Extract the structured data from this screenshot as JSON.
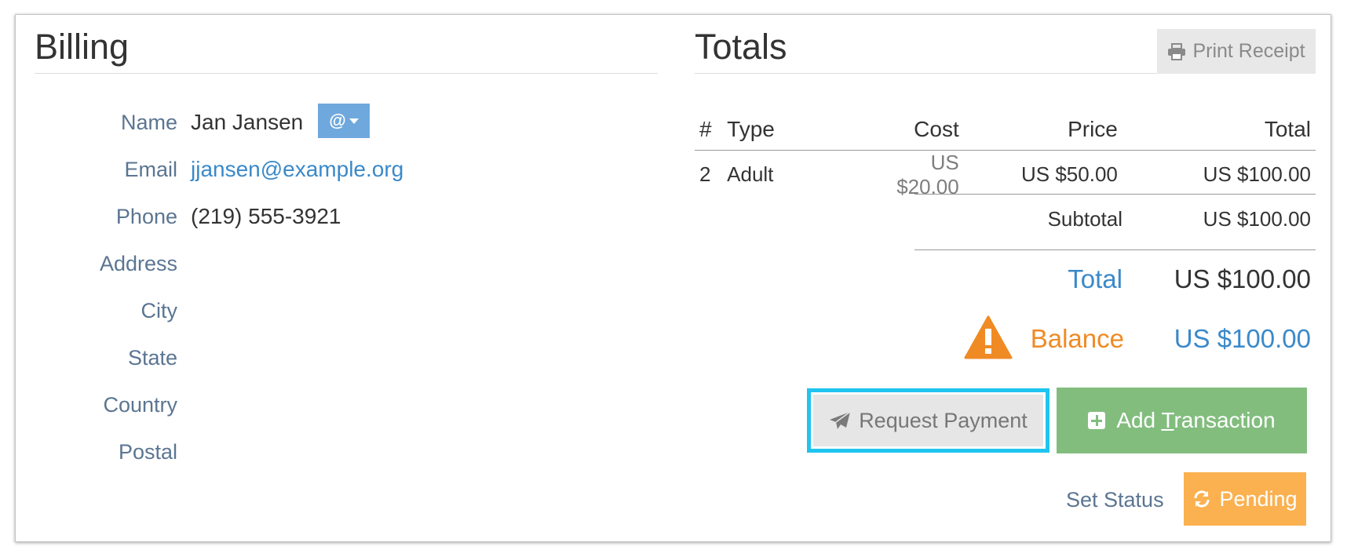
{
  "billing": {
    "title": "Billing",
    "fields": [
      {
        "label": "Name",
        "value": "Jan Jansen"
      },
      {
        "label": "Email",
        "value": "jjansen@example.org"
      },
      {
        "label": "Phone",
        "value": "(219) 555-3921"
      },
      {
        "label": "Address",
        "value": ""
      },
      {
        "label": "City",
        "value": ""
      },
      {
        "label": "State",
        "value": ""
      },
      {
        "label": "Country",
        "value": ""
      },
      {
        "label": "Postal",
        "value": ""
      }
    ],
    "at_button_label": "@"
  },
  "totals": {
    "title": "Totals",
    "print_label": "Print Receipt",
    "table": {
      "headers": [
        "#",
        "Type",
        "Cost",
        "Price",
        "Total"
      ],
      "rows": [
        [
          "2",
          "Adult",
          "US $20.00",
          "US $50.00",
          "US $100.00"
        ]
      ]
    },
    "subtotal_label": "Subtotal",
    "subtotal_value": "US $100.00",
    "total_label": "Total",
    "total_value": "US $100.00",
    "balance_label": "Balance",
    "balance_value": "US $100.00",
    "request_payment_label": "Request Payment",
    "add_transaction_pre": "Add ",
    "add_transaction_ul": "T",
    "add_transaction_post": "ransaction",
    "set_status_label": "Set Status",
    "pending_label": "Pending"
  },
  "colors": {
    "link": "#3a89c9",
    "label": "#5b7592",
    "warning": "#f08a24",
    "success": "#82bd7e",
    "pending": "#fbb14f",
    "highlight": "#1fc4ef"
  }
}
